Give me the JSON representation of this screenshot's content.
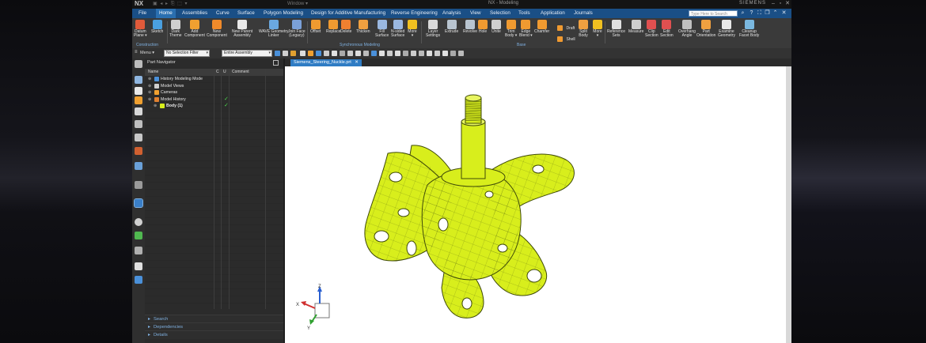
{
  "titlebar": {
    "app_logo": "NX",
    "window_menu": "Window ▾",
    "title": "NX - Modeling",
    "brand": "SIEMENS"
  },
  "menubar": {
    "items": [
      "File",
      "Home",
      "Assemblies",
      "Curve",
      "Surface",
      "Polygon Modeling",
      "Design for Additive Manufacturing",
      "Reverse Engineering",
      "Analysis",
      "View",
      "Selection",
      "Tools",
      "Application",
      "Journals"
    ],
    "active": "Home",
    "search_placeholder": "Type Here to Search"
  },
  "ribbon": {
    "tools": [
      {
        "label": "Datum\nPlane ▾",
        "icon": "datum-plane-icon",
        "color": "#e05a3a"
      },
      {
        "label": "Sketch",
        "icon": "sketch-icon",
        "color": "#4aa0e0"
      },
      {
        "label": "Dark\nTheme",
        "icon": "theme-icon",
        "color": "#cfcfcf"
      },
      {
        "label": "Add\nComponent",
        "icon": "add-component-icon",
        "color": "#f0a030"
      },
      {
        "label": "New\nComponent",
        "icon": "new-component-icon",
        "color": "#f08a2a"
      },
      {
        "label": "New Parent\nAssembly",
        "icon": "new-parent-icon",
        "color": "#e8e8e8"
      },
      {
        "label": "WAVE Geometry\nLinker",
        "icon": "wave-linker-icon",
        "color": "#6aa8e0"
      },
      {
        "label": "Join Face\n(Legacy)",
        "icon": "join-face-icon",
        "color": "#7aa0d8"
      },
      {
        "label": "Offset",
        "icon": "offset-icon",
        "color": "#f09a30"
      },
      {
        "label": "Replace",
        "icon": "replace-icon",
        "color": "#f09a30"
      },
      {
        "label": "Delete",
        "icon": "delete-icon",
        "color": "#f08030"
      },
      {
        "label": "Thicken",
        "icon": "thicken-icon",
        "color": "#f0a040"
      },
      {
        "label": "Fill\nSurface",
        "icon": "fill-surface-icon",
        "color": "#9ab8e0"
      },
      {
        "label": "N-sided\nSurface",
        "icon": "n-sided-icon",
        "color": "#9ab8e0"
      },
      {
        "label": "More\n▾",
        "icon": "lightning-icon",
        "color": "#f0c020"
      },
      {
        "label": "Layer\nSettings",
        "icon": "layer-settings-icon",
        "color": "#d8d8d8"
      },
      {
        "label": "Extrude",
        "icon": "extrude-icon",
        "color": "#b8c4d0"
      },
      {
        "label": "Revolve",
        "icon": "revolve-icon",
        "color": "#b8c4d0"
      },
      {
        "label": "Hole",
        "icon": "hole-icon",
        "color": "#f09a30"
      },
      {
        "label": "Unite",
        "icon": "unite-icon",
        "color": "#d0d0d0"
      },
      {
        "label": "Trim\nBody ▾",
        "icon": "trim-body-icon",
        "color": "#f09a30"
      },
      {
        "label": "Edge\nBlend ▾",
        "icon": "edge-blend-icon",
        "color": "#f09a30"
      },
      {
        "label": "Chamfer",
        "icon": "chamfer-icon",
        "color": "#f09a30"
      },
      {
        "label": "Split\nBody",
        "icon": "split-body-icon",
        "color": "#f0a040"
      },
      {
        "label": "More\n▾",
        "icon": "lightning-icon",
        "color": "#f0c020"
      },
      {
        "label": "Reference\nSets",
        "icon": "reference-sets-icon",
        "color": "#e0e0e0"
      },
      {
        "label": "Measure",
        "icon": "measure-icon",
        "color": "#cfcfcf"
      },
      {
        "label": "Clip\nSection",
        "icon": "clip-section-icon",
        "color": "#e05050"
      },
      {
        "label": "Edit\nSection",
        "icon": "edit-section-icon",
        "color": "#e05050"
      },
      {
        "label": "Overhang\nAngle",
        "icon": "overhang-icon",
        "color": "#c0c0c0"
      },
      {
        "label": "Part\nOrientation",
        "icon": "part-orientation-icon",
        "color": "#f0a040"
      },
      {
        "label": "Examine\nGeometry",
        "icon": "examine-icon",
        "color": "#e8e8e8"
      },
      {
        "label": "Cleanup\nFacet Body",
        "icon": "cleanup-icon",
        "color": "#7ab8e0"
      }
    ],
    "small": [
      {
        "label": "Draft",
        "icon": "draft-icon",
        "color": "#f09a30"
      },
      {
        "label": "Shell",
        "icon": "shell-icon",
        "color": "#f09a30"
      }
    ],
    "groups": [
      "Construction",
      "Synchronous Modeling",
      "Base"
    ]
  },
  "toolbar2": {
    "menu_label": "Menu ▾",
    "selection_filter": "No Selection Filter",
    "scope": "Entire Assembly"
  },
  "navigator": {
    "title": "Part Navigator",
    "columns": [
      "Name",
      "C",
      "U",
      "Comment"
    ],
    "rows": [
      {
        "name": "History Modeling Mode",
        "indent": 0,
        "check": false,
        "icon": "history-mode-icon"
      },
      {
        "name": "Model Views",
        "indent": 0,
        "check": false,
        "icon": "model-views-icon"
      },
      {
        "name": "Cameras",
        "indent": 0,
        "check": false,
        "icon": "cameras-icon"
      },
      {
        "name": "Model History",
        "indent": 0,
        "check": true,
        "icon": "model-history-icon"
      },
      {
        "name": "Body (1)",
        "indent": 1,
        "check": true,
        "icon": "body-icon"
      }
    ],
    "footer": [
      "Search",
      "Dependencies",
      "Details"
    ]
  },
  "viewport": {
    "tab": "Siemens_Steering_Nuckle.prt",
    "triad": {
      "x": "X",
      "y": "Y",
      "z": "Z"
    }
  },
  "colors": {
    "menubar": "#1a4f86",
    "part_fill": "#d8ee1c",
    "part_edge": "#3f4a08"
  }
}
